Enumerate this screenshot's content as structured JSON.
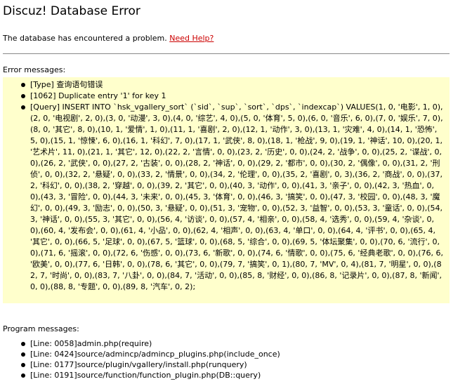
{
  "page": {
    "title": "Discuz! Database Error"
  },
  "info": {
    "text": "The database has encountered a problem.",
    "help_link": "Need Help?"
  },
  "errors": {
    "heading": "Error messages:",
    "items": [
      "[Type] 查询语句错误",
      "[1062] Duplicate entry '1' for key 1",
      "[Query] INSERT INTO `hsk_vgallery_sort` (`sid`, `sup`, `sort`, `dps`, `indexcap`) VALUES(1, 0, '电影', 1, 0),(2, 0, '电视剧', 2, 0),(3, 0, '动漫', 3, 0),(4, 0, '综艺', 4, 0),(5, 0, '体育', 5, 0),(6, 0, '音乐', 6, 0),(7, 0, '娱乐', 7, 0),(8, 0, '其它', 8, 0),(10, 1, '爱情', 1, 0),(11, 1, '喜剧', 2, 0),(12, 1, '动作', 3, 0),(13, 1, '灾难', 4, 0),(14, 1, '恐怖', 5, 0),(15, 1, '惊悚', 6, 0),(16, 1, '科幻', 7, 0),(17, 1, '武侠', 8, 0),(18, 1, '枪战', 9, 0),(19, 1, '神话', 10, 0),(20, 1, '艺术片', 11, 0),(21, 1, '其它', 12, 0),(22, 2, '言情', 0, 0),(23, 2, '历史', 0, 0),(24, 2, '战争', 0, 0),(25, 2, '谍战', 0, 0),(26, 2, '武侠', 0, 0),(27, 2, '古装', 0, 0),(28, 2, '神话', 0, 0),(29, 2, '都市', 0, 0),(30, 2, '偶像', 0, 0),(31, 2, '刑侦', 0, 0),(32, 2, '悬疑', 0, 0),(33, 2, '情景', 0, 0),(34, 2, '伦理', 0, 0),(35, 2, '喜剧', 0, 3),(36, 2, '商战', 0, 0),(37, 2, '科幻', 0, 0),(38, 2, '穿越', 0, 0),(39, 2, '其它', 0, 0),(40, 3, '动作', 0, 0),(41, 3, '亲子', 0, 0),(42, 3, '热血', 0, 0),(43, 3, '冒险', 0, 0),(44, 3, '未来', 0, 0),(45, 3, '体育', 0, 0),(46, 3, '搞笑', 0, 0),(47, 3, '校园', 0, 0),(48, 3, '魔幻', 0, 0),(49, 3, '励志', 0, 0),(50, 3, '悬疑', 0, 0),(51, 3, '宠物', 0, 0),(52, 3, '益智', 0, 0),(53, 3, '童话', 0, 0),(54, 3, '神话', 0, 0),(55, 3, '其它', 0, 0),(56, 4, '访谈', 0, 0),(57, 4, '相亲', 0, 0),(58, 4, '选秀', 0, 0),(59, 4, '杂谈', 0, 0),(60, 4, '发布会', 0, 0),(61, 4, '小品', 0, 0),(62, 4, '相声', 0, 0),(63, 4, '单口', 0, 0),(64, 4, '评书', 0, 0),(65, 4, '其它', 0, 0),(66, 5, '足球', 0, 0),(67, 5, '篮球', 0, 0),(68, 5, '综合', 0, 0),(69, 5, '体坛聚集', 0, 0),(70, 6, '流行', 0, 0),(71, 6, '摇滚', 0, 0),(72, 6, '伤感', 0, 0),(73, 6, '新歌', 0, 0),(74, 6, '情歌', 0, 0),(75, 6, '经典老歌', 0, 0),(76, 6, '欧美', 0, 0),(77, 6, '日韩', 0, 0),(78, 6, '其它', 0, 0),(79, 7, '搞笑', 0, 1),(80, 7, 'MV', 0, 4),(81, 7, '明星', 0, 0),(82, 7, '时尚', 0, 0),(83, 7, '八卦', 0, 0),(84, 7, '活动', 0, 0),(85, 8, '财经', 0, 0),(86, 8, '记录片', 0, 0),(87, 8, '新闻', 0, 0),(88, 8, '专题', 0, 0),(89, 8, '汽车', 0, 2);"
    ]
  },
  "program": {
    "heading": "Program messages:",
    "items": [
      "[Line: 0058]admin.php(require)",
      "[Line: 0424]source/admincp/admincp_plugins.php(include_once)",
      "[Line: 0177]source/plugin/vgallery/install.php(runquery)",
      "[Line: 0191]source/function/function_plugin.php(DB::query)"
    ]
  }
}
